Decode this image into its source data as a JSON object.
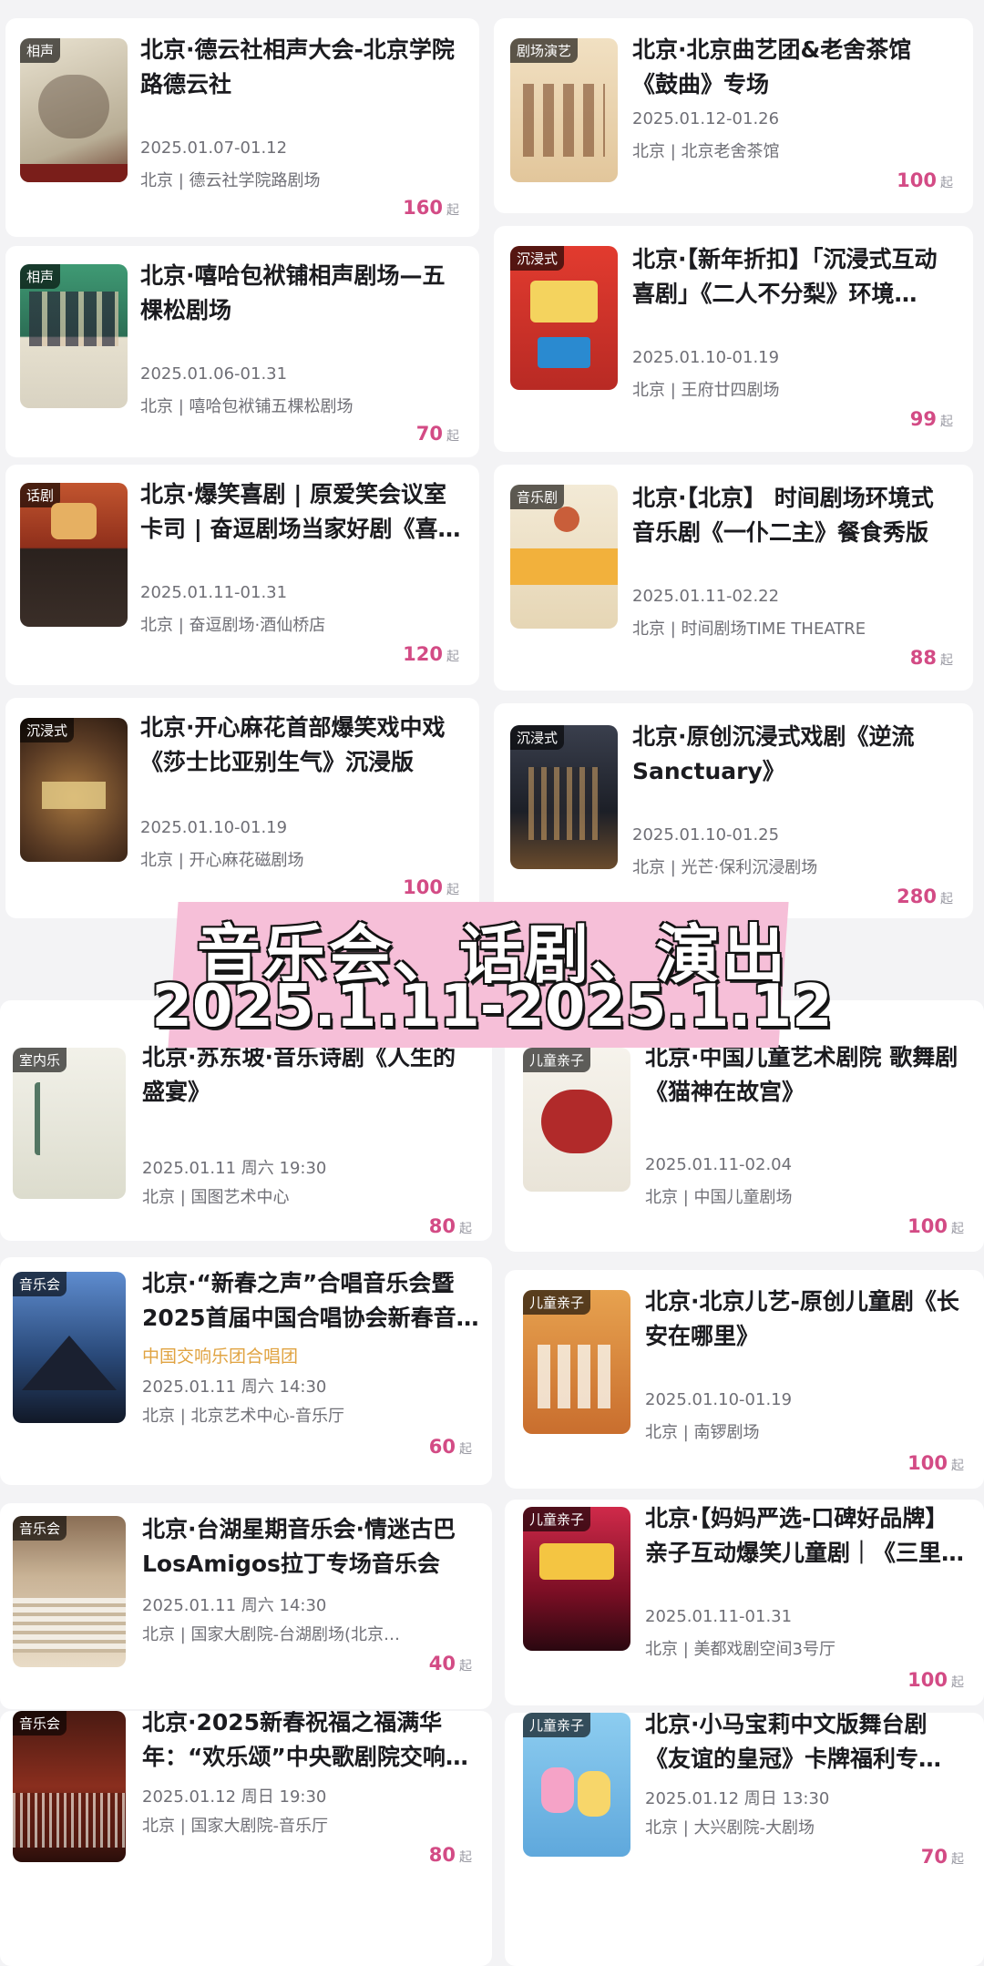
{
  "banner": {
    "line1": "音乐会、话剧、演出",
    "line2": "2025.1.11-2025.1.12"
  },
  "price_suffix": "起",
  "top_left": [
    {
      "tag": "相声",
      "title": "北京·德云社相声大会-北京学院路德云社",
      "date": "2025.01.07-01.12",
      "venue": "北京 | 德云社学院路剧场",
      "price": "160",
      "color": "#cfc7b3"
    },
    {
      "tag": "相声",
      "title": "北京·嘻哈包袱铺相声剧场—五棵松剧场",
      "date": "2025.01.06-01.31",
      "venue": "北京 | 嘻哈包袱铺五棵松剧场",
      "price": "70",
      "color": "#4c8a6b"
    },
    {
      "tag": "话剧",
      "title": "北京·爆笑喜剧 | 原爱笑会议室卡司 | 奋逗剧场当家好剧《喜宴…",
      "date": "2025.01.11-01.31",
      "venue": "北京 | 奋逗剧场·酒仙桥店",
      "price": "120",
      "color": "#b4482a"
    },
    {
      "tag": "沉浸式",
      "title": "北京·开心麻花首部爆笑戏中戏《莎士比亚别生气》沉浸版",
      "date": "2025.01.10-01.19",
      "venue": "北京 | 开心麻花磁剧场",
      "price": "100",
      "color": "#5a3b24"
    }
  ],
  "top_right": [
    {
      "tag": "剧场演艺",
      "title": "北京·北京曲艺团&老舍茶馆《鼓曲》专场",
      "date": "2025.01.12-01.26",
      "venue": "北京 | 北京老舍茶馆",
      "price": "100",
      "color": "#e8d2b0"
    },
    {
      "tag": "沉浸式",
      "title": "北京·【新年折扣】「沉浸式互动喜剧」《二人不分梨》环境…",
      "date": "2025.01.10-01.19",
      "venue": "北京 | 王府廿四剧场",
      "price": "99",
      "color": "#d8342f"
    },
    {
      "tag": "音乐剧",
      "title": "北京·【北京】 时间剧场环境式音乐剧《一仆二主》餐食秀版",
      "date": "2025.01.11-02.22",
      "venue": "北京 | 时间剧场TIME THEATRE",
      "price": "88",
      "color": "#efe3c9"
    },
    {
      "tag": "沉浸式",
      "title": "北京·原创沉浸式戏剧《逆流Sanctuary》",
      "date": "2025.01.10-01.25",
      "venue": "北京 | 光芒·保利沉浸剧场",
      "price": "280",
      "color": "#2b2f3a"
    }
  ],
  "bottom_left": [
    {
      "tag": "室内乐",
      "title": "北京·苏东坡·音乐诗剧《人生的盛宴》",
      "performer": "",
      "date": "2025.01.11 周六 19:30",
      "venue": "北京 | 国图艺术中心",
      "price": "80",
      "color": "#e7e6dc"
    },
    {
      "tag": "音乐会",
      "title": "北京·“新春之声”合唱音乐会暨2025首届中国合唱协会新春音…",
      "performer": "中国交响乐团合唱团",
      "date": "2025.01.11 周六 14:30",
      "venue": "北京 | 北京艺术中心-音乐厅",
      "price": "60",
      "color": "#2a4a7a"
    },
    {
      "tag": "音乐会",
      "title": "北京·台湖星期音乐会·情迷古巴LosAmigos拉丁专场音乐会",
      "performer": "",
      "date": "2025.01.11 周六 14:30",
      "venue": "北京 | 国家大剧院-台湖剧场(北京…",
      "price": "40",
      "color": "#b8a48c"
    },
    {
      "tag": "音乐会",
      "title": "北京·2025新春祝福之福满华年：“欢乐颂”中央歌剧院交响…",
      "performer": "",
      "date": "2025.01.12 周日 19:30",
      "venue": "北京 | 国家大剧院-音乐厅",
      "price": "80",
      "color": "#6a2a1e"
    }
  ],
  "bottom_right": [
    {
      "tag": "儿童亲子",
      "title": "北京·中国儿童艺术剧院 歌舞剧《猫神在故宫》",
      "date": "2025.01.11-02.04",
      "venue": "北京 | 中国儿童剧场",
      "price": "100",
      "color": "#f1ede4"
    },
    {
      "tag": "儿童亲子",
      "title": "北京·北京儿艺-原创儿童剧《长安在哪里》",
      "date": "2025.01.10-01.19",
      "venue": "北京 | 南锣剧场",
      "price": "100",
      "color": "#d98a3a"
    },
    {
      "tag": "儿童亲子",
      "title": "北京·【妈妈严选-口碑好品牌】亲子互动爆笑儿童剧｜《三里…",
      "date": "2025.01.11-01.31",
      "venue": "北京 | 美都戏剧空间3号厅",
      "price": "100",
      "color": "#8a1a2a"
    },
    {
      "tag": "儿童亲子",
      "title": "北京·小马宝莉中文版舞台剧《友谊的皇冠》卡牌福利专场-…",
      "date": "2025.01.12 周日 13:30",
      "venue": "北京 | 大兴剧院-大剧场",
      "price": "70",
      "color": "#7fc0e8"
    }
  ]
}
